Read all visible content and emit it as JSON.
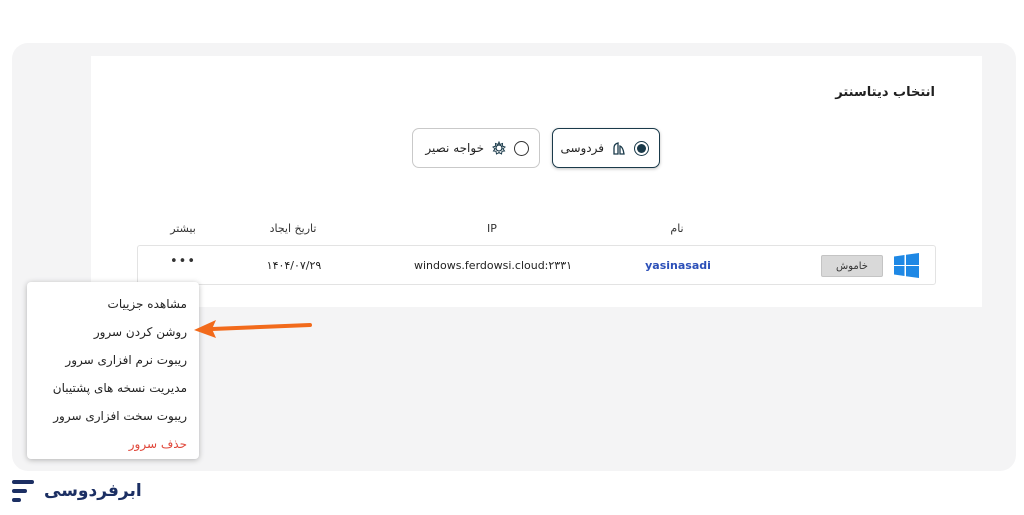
{
  "panel": {
    "title": "انتخاب دیتاسنتر"
  },
  "datacenters": [
    {
      "label": "فردوسی",
      "selected": true,
      "icon": "ferdowsi-icon"
    },
    {
      "label": "خواجه نصیر",
      "selected": false,
      "icon": "khajeh-nasir-icon"
    }
  ],
  "table": {
    "headers": {
      "name": "نام",
      "ip": "IP",
      "created": "تاریخ ایجاد",
      "more": "بیشتر"
    },
    "rows": [
      {
        "os_icon": "windows-icon",
        "status": "خاموش",
        "name": "yasinasadi",
        "ip": "windows.ferdowsi.cloud:۲۳۳۱",
        "created": "۱۴۰۴/۰۷/۲۹",
        "more": "•••"
      }
    ]
  },
  "menu": {
    "items": [
      {
        "label": "مشاهده جزییات"
      },
      {
        "label": "روشن کردن سرور"
      },
      {
        "label": "ریبوت نرم افزاری سرور"
      },
      {
        "label": "مدیریت نسخه های پشتیبان"
      },
      {
        "label": "ریبوت سخت افزاری سرور"
      },
      {
        "label": "حذف سرور"
      }
    ]
  },
  "brand": {
    "name": "ابرفردوسی",
    "color": "#1c2f63"
  },
  "colors": {
    "arrow": "#f26a1b",
    "danger": "#e0473a",
    "link": "#2b4fb8",
    "windows": "#1e88e5"
  }
}
